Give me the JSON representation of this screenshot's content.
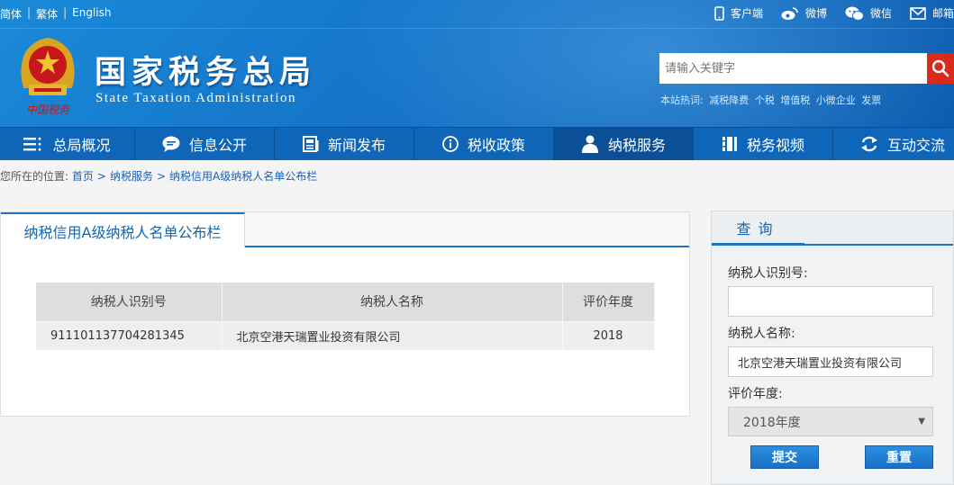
{
  "topbar": {
    "lang": [
      "简体",
      "繁体",
      "English"
    ],
    "links": [
      {
        "label": "客户端",
        "icon": "mobile-icon"
      },
      {
        "label": "微博",
        "icon": "weibo-icon"
      },
      {
        "label": "微信",
        "icon": "wechat-icon"
      },
      {
        "label": "邮箱",
        "icon": "mail-icon"
      }
    ]
  },
  "header": {
    "emblem_text": "中国税务",
    "title": "国家税务总局",
    "subtitle": "State Taxation Administration",
    "search_placeholder": "请输入关键字",
    "hotwords_label": "本站热词:",
    "hotwords": [
      "减税降费",
      "个税",
      "增值税",
      "小微企业",
      "发票"
    ]
  },
  "nav": [
    {
      "label": "总局概况",
      "icon": "list-icon"
    },
    {
      "label": "信息公开",
      "icon": "chat-bubble-icon"
    },
    {
      "label": "新闻发布",
      "icon": "newspaper-icon"
    },
    {
      "label": "税收政策",
      "icon": "info-circle-icon"
    },
    {
      "label": "纳税服务",
      "icon": "person-icon",
      "active": true
    },
    {
      "label": "税务视频",
      "icon": "film-icon"
    },
    {
      "label": "互动交流",
      "icon": "exchange-icon"
    }
  ],
  "breadcrumb": {
    "prefix": "您所在的位置:",
    "items": [
      "首页",
      "纳税服务",
      "纳税信用A级纳税人名单公布栏"
    ]
  },
  "main": {
    "tab_label": "纳税信用A级纳税人名单公布栏",
    "columns": [
      "纳税人识别号",
      "纳税人名称",
      "评价年度"
    ],
    "rows": [
      [
        "911101137704281345",
        "北京空港天瑞置业投资有限公司",
        "2018"
      ]
    ]
  },
  "query": {
    "title": "查询",
    "taxpayer_id_label": "纳税人识别号:",
    "taxpayer_id_value": "",
    "taxpayer_name_label": "纳税人名称:",
    "taxpayer_name_value": "北京空港天瑞置业投资有限公司",
    "year_label": "评价年度:",
    "year_value": "2018年度",
    "submit_label": "提交",
    "reset_label": "重置"
  },
  "colors": {
    "header_blue": "#1574c8",
    "nav_blue": "#0f66b9",
    "accent": "#1e73be",
    "search_red": "#d92a1c"
  }
}
